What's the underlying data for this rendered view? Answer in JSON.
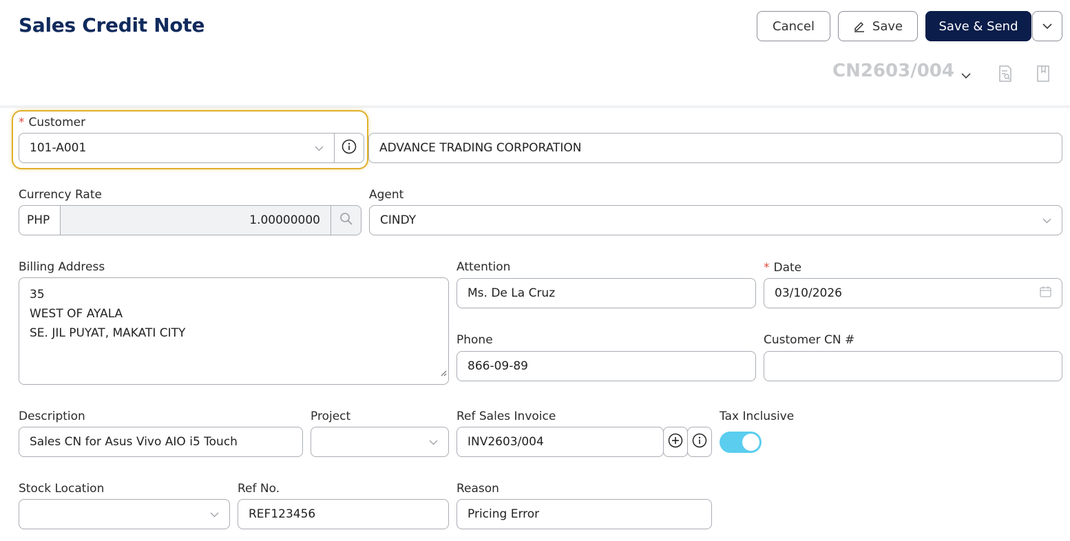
{
  "header": {
    "title": "Sales Credit Note",
    "cancel_label": "Cancel",
    "save_label": "Save",
    "save_send_label": "Save & Send",
    "doc_number": "CN2603/004"
  },
  "form": {
    "customer": {
      "label": "Customer",
      "required": true,
      "code": "101-A001",
      "name": "ADVANCE TRADING CORPORATION"
    },
    "currency_rate": {
      "label": "Currency Rate",
      "currency": "PHP",
      "rate": "1.00000000"
    },
    "agent": {
      "label": "Agent",
      "value": "CINDY"
    },
    "billing_address": {
      "label": "Billing Address",
      "line1": "35",
      "line2": "WEST OF AYALA",
      "line3": "SE. JIL PUYAT, MAKATI CITY"
    },
    "attention": {
      "label": "Attention",
      "value": "Ms. De La Cruz"
    },
    "date": {
      "label": "Date",
      "required": true,
      "value": "03/10/2026"
    },
    "phone": {
      "label": "Phone",
      "value": "866-09-89"
    },
    "customer_cn": {
      "label": "Customer CN #",
      "value": ""
    },
    "description": {
      "label": "Description",
      "value": "Sales CN for Asus Vivo AIO i5 Touch"
    },
    "project": {
      "label": "Project",
      "value": ""
    },
    "ref_sales_invoice": {
      "label": "Ref Sales Invoice",
      "value": "INV2603/004"
    },
    "tax_inclusive": {
      "label": "Tax Inclusive",
      "enabled": true
    },
    "stock_location": {
      "label": "Stock Location",
      "value": ""
    },
    "ref_no": {
      "label": "Ref No.",
      "value": "REF123456"
    },
    "reason": {
      "label": "Reason",
      "value": "Pricing Error"
    }
  },
  "colors": {
    "primary": "#0b1d4a",
    "title": "#102a5c",
    "highlight": "#e0b02a",
    "toggle_on": "#5bcdef",
    "required": "#e0493d"
  }
}
